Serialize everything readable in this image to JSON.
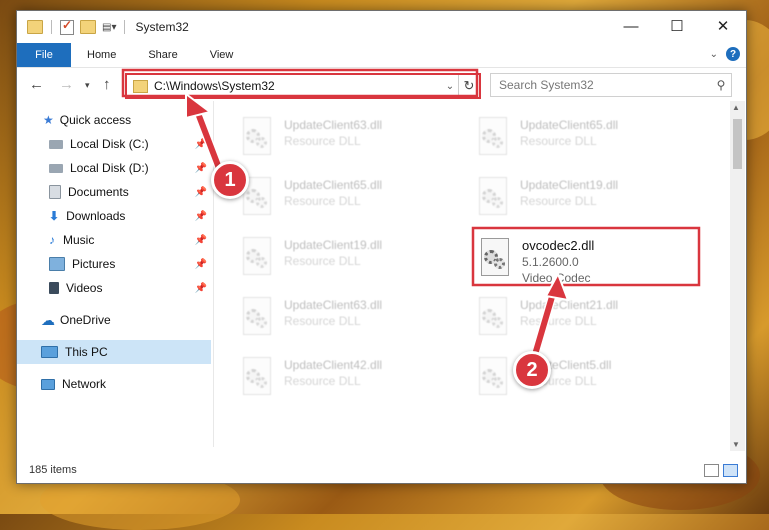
{
  "window": {
    "title": "System32"
  },
  "ribbon": {
    "tabs": [
      "File",
      "Home",
      "Share",
      "View"
    ]
  },
  "navbar": {
    "address": "C:\\Windows\\System32",
    "search_placeholder": "Search System32"
  },
  "sidebar": {
    "items": [
      {
        "label": "Quick access",
        "icon": "star-icon",
        "pinned": false
      },
      {
        "label": "Local Disk (C:)",
        "icon": "drive-icon",
        "pinned": true
      },
      {
        "label": "Local Disk (D:)",
        "icon": "drive-icon",
        "pinned": true
      },
      {
        "label": "Documents",
        "icon": "document-icon",
        "pinned": true
      },
      {
        "label": "Downloads",
        "icon": "download-icon",
        "pinned": true
      },
      {
        "label": "Music",
        "icon": "music-icon",
        "pinned": true
      },
      {
        "label": "Pictures",
        "icon": "pictures-icon",
        "pinned": true
      },
      {
        "label": "Videos",
        "icon": "videos-icon",
        "pinned": true
      },
      {
        "label": "OneDrive",
        "icon": "cloud-icon",
        "pinned": false
      },
      {
        "label": "This PC",
        "icon": "computer-icon",
        "pinned": false,
        "selected": true
      },
      {
        "label": "Network",
        "icon": "network-icon",
        "pinned": false
      }
    ]
  },
  "files": [
    {
      "name": "UpdateClient63.dll",
      "type": "Resource DLL"
    },
    {
      "name": "UpdateClient65.dll",
      "type": "Resource DLL"
    },
    {
      "name": "UpdateClient65.dll",
      "type": "Resource DLL"
    },
    {
      "name": "UpdateClient19.dll",
      "type": "Resource DLL"
    },
    {
      "name": "UpdateClient19.dll",
      "type": "Resource DLL"
    },
    {
      "name": "ovcodec2.dll",
      "version": "5.1.2600.0",
      "type": "Video Codec",
      "highlighted": true
    },
    {
      "name": "UpdateClient63.dll",
      "type": "Resource DLL"
    },
    {
      "name": "UpdateClient21.dll",
      "type": "Resource DLL"
    },
    {
      "name": "UpdateClient42.dll",
      "type": "Resource DLL"
    },
    {
      "name": "UpdateClient5.dll",
      "type": "Resource DLL"
    }
  ],
  "status": {
    "item_count": "185 items"
  },
  "annotations": {
    "step1": "1",
    "step2": "2"
  },
  "colors": {
    "accent": "#1e6ebd",
    "highlight": "#d9363e",
    "selected": "#cce4f7"
  }
}
